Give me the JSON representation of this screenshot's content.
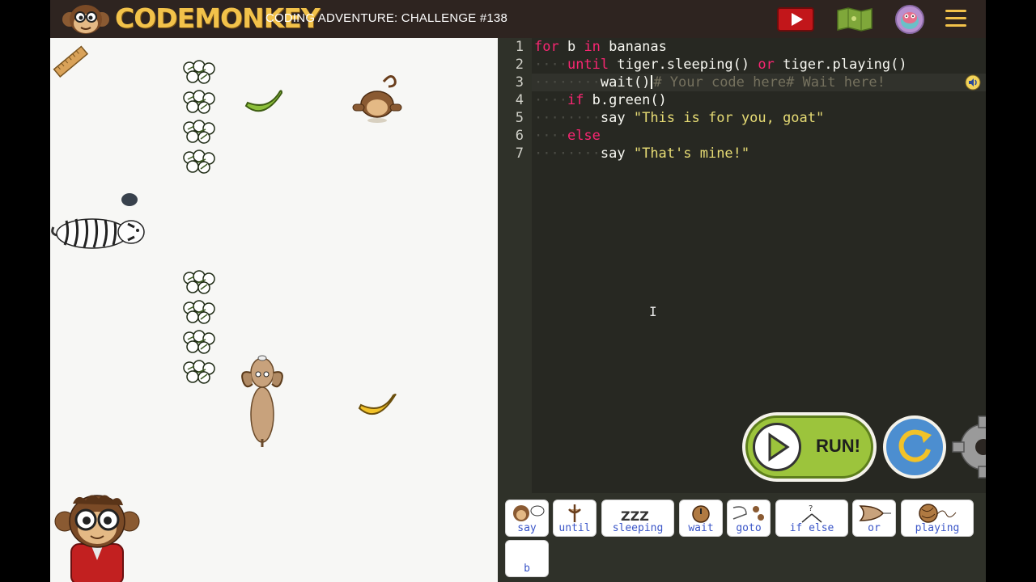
{
  "header": {
    "logo_text": "CODEMONKEY",
    "title": "CODING ADVENTURE: CHALLENGE #138"
  },
  "editor": {
    "line_numbers": [
      "1",
      "2",
      "3",
      "4",
      "5",
      "6",
      "7"
    ],
    "lines": {
      "l1": {
        "kw1": "for",
        "t1": " b ",
        "kw2": "in",
        "t2": " bananas"
      },
      "l2": {
        "kw1": "until",
        "t1": " tiger.sleeping() ",
        "kw2": "or",
        "t2": " tiger.playing()"
      },
      "l3": {
        "t1": "wait()",
        "comment": "# Your code here# Wait here!"
      },
      "l4": {
        "kw1": "if",
        "t1": " b.green()"
      },
      "l5": {
        "t1": "say ",
        "str": "\"This is for you, goat\""
      },
      "l6": {
        "kw1": "else"
      },
      "l7": {
        "t1": "say ",
        "str": "\"That's mine!\""
      }
    },
    "run_label": "RUN!"
  },
  "palette": {
    "items": [
      {
        "label": "say"
      },
      {
        "label": "until"
      },
      {
        "label": "sleeping"
      },
      {
        "label": "wait"
      },
      {
        "label": "goto"
      },
      {
        "label": "if else"
      },
      {
        "label": "or"
      },
      {
        "label": "playing"
      },
      {
        "label": "b"
      }
    ]
  },
  "colors": {
    "keyword": "#f92672",
    "string": "#e6db74",
    "comment": "#75715e",
    "run_green": "#9cc43c",
    "logo_yellow": "#f2c24a"
  }
}
